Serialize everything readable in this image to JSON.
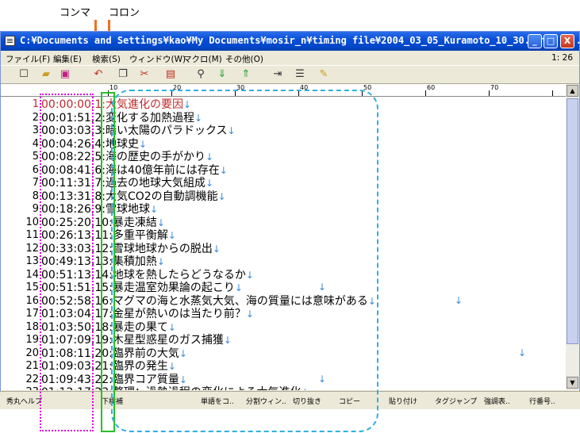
{
  "annotations": {
    "comma_label": "コンマ",
    "colon_label": "コロン"
  },
  "window": {
    "title": "C:¥Documents and Settings¥kao¥My Documents¥mosir_n¥timing file¥2004_03_05_Kuramoto_10_30.txt - ...",
    "minimize": "_",
    "maximize": "□",
    "close": "X"
  },
  "menu": {
    "items": [
      "ファイル(F)",
      "編集(E)",
      "検索(S)",
      "ウィンドウ(W)",
      "マクロ(M)",
      "その他(O)"
    ],
    "position": "1: 26"
  },
  "toolbar": {
    "icons": [
      "new-file-icon",
      "open-folder-icon",
      "save-icon",
      "undo-icon",
      "copy-icon",
      "cut-icon",
      "paste-icon",
      "search-icon",
      "search-down-icon",
      "search-up-icon",
      "tag-jump-icon",
      "split-icon",
      "highlight-icon"
    ]
  },
  "ruler": {
    "marks": [
      "10",
      "20",
      "30",
      "40",
      "50",
      "60",
      "70"
    ]
  },
  "lines": [
    {
      "num": "1",
      "text": "00:00:00,1:大気進化の要因",
      "current": true
    },
    {
      "num": "2",
      "text": "00:01:51,2:変化する加熱過程"
    },
    {
      "num": "3",
      "text": "00:03:03,3:暗い太陽のパラドックス"
    },
    {
      "num": "4",
      "text": "00:04:26,4:地球史"
    },
    {
      "num": "5",
      "text": "00:08:22,5:海の歴史の手がかり"
    },
    {
      "num": "6",
      "text": "00:08:41,6:海は40億年前には存在"
    },
    {
      "num": "7",
      "text": "00:11:31,7:過去の地球大気組成"
    },
    {
      "num": "8",
      "text": "00:13:31,8:大気CO2の自動調機能"
    },
    {
      "num": "9",
      "text": "00:18:26,9:雪球地球"
    },
    {
      "num": "10",
      "text": "00:25:20,10:暴走凍結"
    },
    {
      "num": "11",
      "text": "00:26:13,11:多重平衡解"
    },
    {
      "num": "12",
      "text": "00:33:03,12:雪球地球からの脱出"
    },
    {
      "num": "13",
      "text": "00:49:13,13:集積加熱"
    },
    {
      "num": "14",
      "text": "00:51:13,14:地球を熱したらどうなるか"
    },
    {
      "num": "15",
      "text": "00:51:51,15:暴走温室効果論の起こり"
    },
    {
      "num": "16",
      "text": "00:52:58,16:マグマの海と水蒸気大気、海の質量には意味がある"
    },
    {
      "num": "17",
      "text": "01:03:04,17:金星が熱いのは当たり前？"
    },
    {
      "num": "18",
      "text": "01:03:50,18:暴走の果て"
    },
    {
      "num": "19",
      "text": "01:07:09,19:木星型惑星のガス捕獲"
    },
    {
      "num": "20",
      "text": "01:08:11,20:臨界前の大気"
    },
    {
      "num": "21",
      "text": "01:09:03,21:臨界の発生"
    },
    {
      "num": "22",
      "text": "01:09:43,22:臨界コア質量"
    },
    {
      "num": "23",
      "text": "01:12:17,23:整理：過熱過程の変化による大気進化"
    }
  ],
  "fkeys": [
    "秀丸ヘルプ",
    "下検補",
    "単語をコ..",
    "分割ウィン..",
    "切り抜き",
    "コピー",
    "貼り付け",
    "タグジャンプ",
    "強調表..",
    "行番号.."
  ],
  "eol_mark": "↓"
}
